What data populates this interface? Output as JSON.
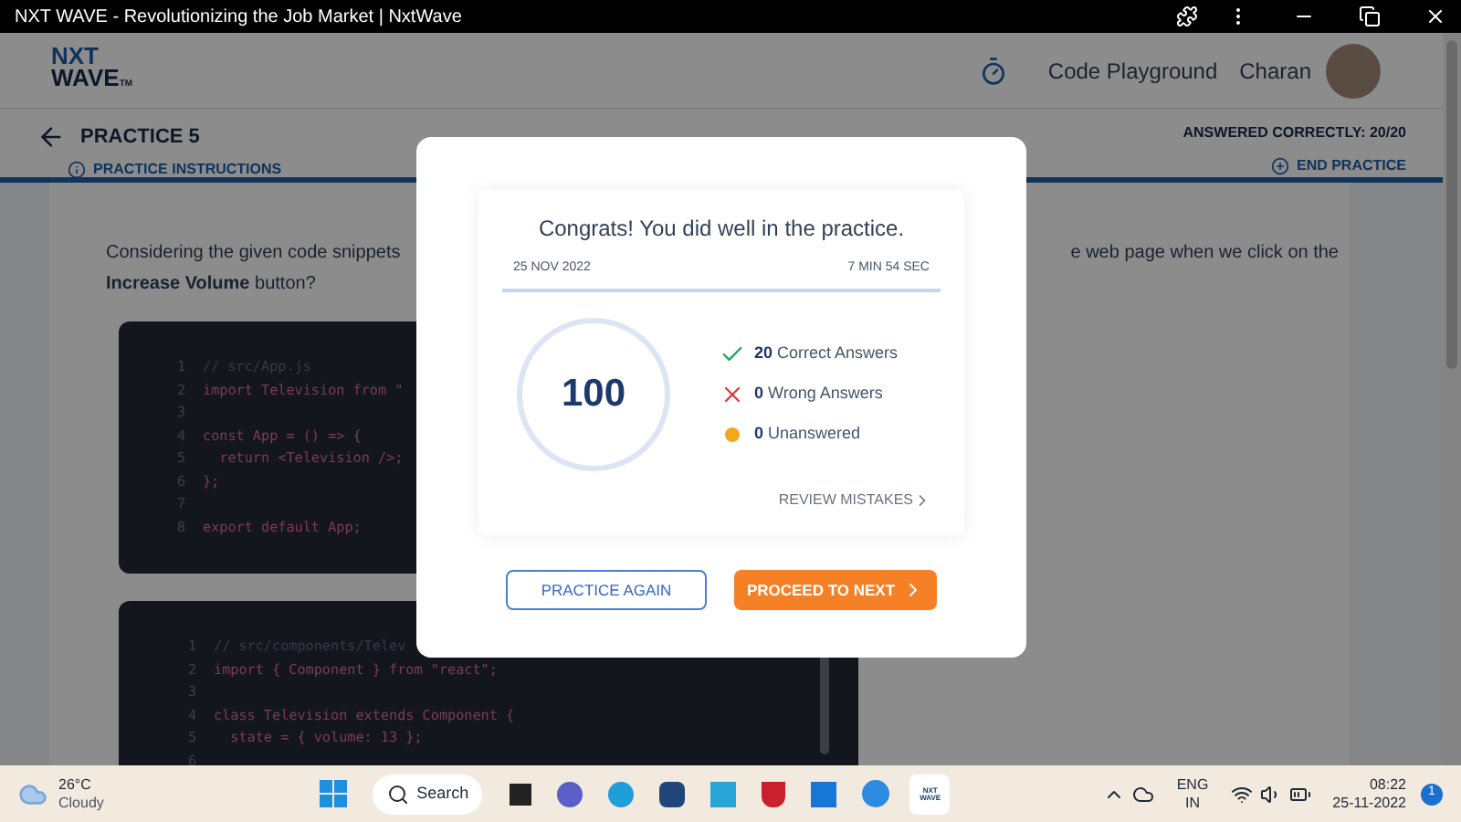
{
  "browser": {
    "title": "NXT WAVE - Revolutionizing the Job Market | NxtWave"
  },
  "header": {
    "logo_top": "NXT",
    "logo_bottom": "WAVE",
    "logo_mark": "TM",
    "links": [
      "Code Playground"
    ],
    "user": "Charan"
  },
  "practice_bar": {
    "title": "PRACTICE 5",
    "instructions": "PRACTICE INSTRUCTIONS",
    "answered": "ANSWERED CORRECTLY: 20/20",
    "end": "END PRACTICE"
  },
  "question": {
    "start": "Considering the given code snippets",
    "end": "e web page when we click on the",
    "line2": "**Increase Volume** button?"
  },
  "code_blocks": [
    {
      "lines": [
        {
          "n": "1",
          "text": "// src/App.js",
          "kind": "comment"
        },
        {
          "n": "2",
          "text": "import Television from \"",
          "kind": "code"
        },
        {
          "n": "3",
          "kind": "blank"
        },
        {
          "n": "4",
          "text": "const App = () => {",
          "kind": "code"
        },
        {
          "n": "5",
          "text": "  return <Television />;",
          "kind": "code"
        },
        {
          "n": "6",
          "text": "};",
          "kind": "code"
        },
        {
          "n": "7",
          "kind": "blank"
        },
        {
          "n": "8",
          "text": "export default App;",
          "kind": "code"
        }
      ]
    },
    {
      "lines": [
        {
          "n": "1",
          "text": "// src/components/Telev",
          "kind": "comment"
        },
        {
          "n": "2",
          "text": "import { Component } from \"react\";",
          "kind": "code"
        },
        {
          "n": "3",
          "kind": "blank"
        },
        {
          "n": "4",
          "text": "class Television extends Component {",
          "kind": "code"
        },
        {
          "n": "5",
          "text": "  state = { volume: 13 };",
          "kind": "code"
        },
        {
          "n": "6",
          "kind": "blank"
        }
      ]
    }
  ],
  "modal": {
    "title": "Congrats! You did well in the practice.",
    "date": "25 NOV 2022",
    "duration": "7 MIN 54 SEC",
    "score": "100",
    "stats": [
      {
        "kind": "correct",
        "count": "20",
        "label": "Correct Answers"
      },
      {
        "kind": "wrong",
        "count": "0",
        "label": "Wrong Answers"
      },
      {
        "kind": "unanswered",
        "count": "0",
        "label": "Unanswered"
      }
    ],
    "review": "REVIEW MISTAKES",
    "buttons": [
      {
        "kind": "outline",
        "label": "PRACTICE AGAIN"
      },
      {
        "kind": "primary",
        "label": "PROCEED TO NEXT"
      }
    ]
  },
  "taskbar": {
    "temperature": "26°C",
    "weather": "Cloudy",
    "search": "Search",
    "language": "ENG",
    "region": "IN",
    "time": "08:22",
    "date": "25-11-2022",
    "notifications": "1",
    "app_label_top": "NXT",
    "app_label_bottom": "WAVE"
  }
}
